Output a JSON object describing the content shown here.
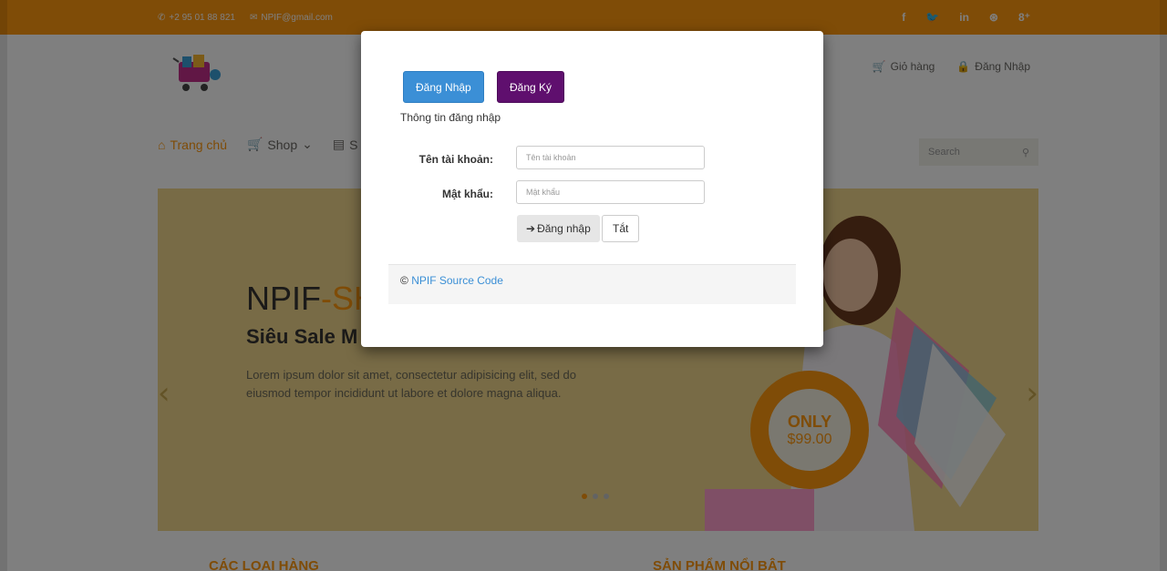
{
  "topbar": {
    "phone": "+2 95 01 88 821",
    "email": "NPIF@gmail.com",
    "social": [
      "f",
      "🐦",
      "in",
      "⊛",
      "8⁺"
    ]
  },
  "header": {
    "cart_label": "Giỏ hàng",
    "login_label": "Đăng Nhập"
  },
  "nav": {
    "home": "Trang chủ",
    "shop": "Shop",
    "sale_partial": "S"
  },
  "search": {
    "placeholder": "Search"
  },
  "slider": {
    "title_main": "NPIF",
    "title_accent": "-SH",
    "subtitle": "Siêu Sale M",
    "description": "Lorem ipsum dolor sit amet, consectetur adipisicing elit, sed do eiusmod tempor incididunt ut labore et dolore magna aliqua.",
    "badge_only": "ONLY",
    "badge_price": "$99.00"
  },
  "sections": {
    "categories": "CÁC LOẠI HÀNG",
    "featured": "SẢN PHẨM NỔI BẬT"
  },
  "modal": {
    "tab_login": "Đăng Nhập",
    "tab_register": "Đăng Ký",
    "section_title": "Thông tin đăng nhập",
    "username_label": "Tên tài khoản:",
    "username_placeholder": "Tên tài khoản",
    "password_label": "Mật khẩu:",
    "password_placeholder": "Mật khẩu",
    "login_button": "Đăng nhập",
    "close_button": "Tắt",
    "footer_copyright": "©",
    "footer_link": "NPIF Source Code"
  },
  "colors": {
    "accent": "#fe980f",
    "login_tab": "#3b8fd6",
    "register_tab": "#5f0f6e"
  }
}
